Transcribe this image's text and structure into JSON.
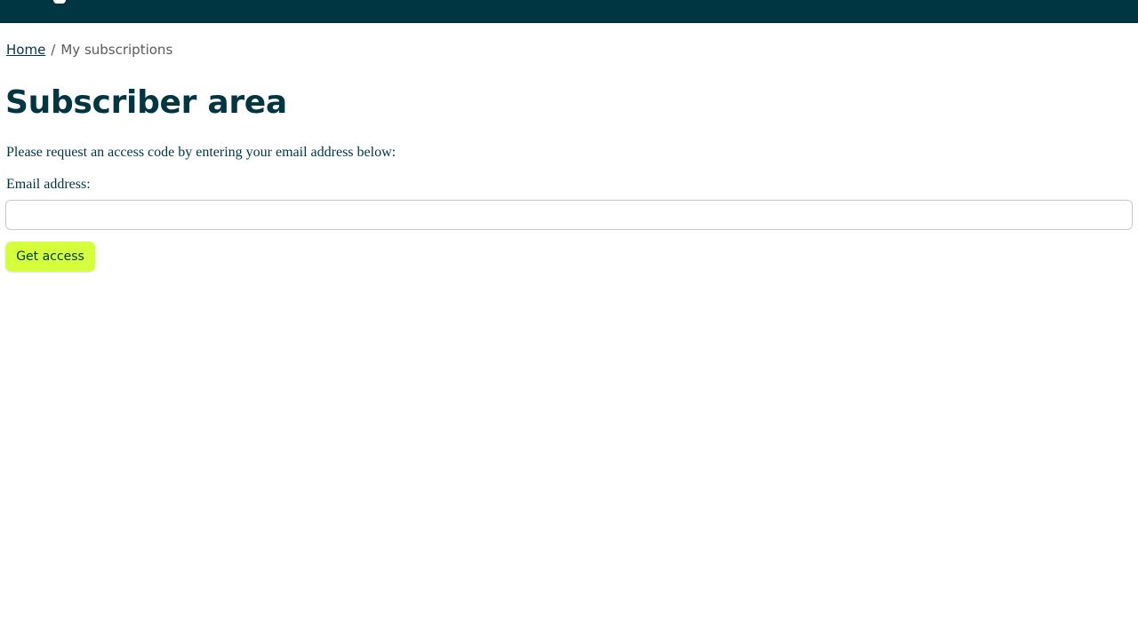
{
  "breadcrumb": {
    "home_label": "Home",
    "separator": "/",
    "current_label": "My subscriptions"
  },
  "page": {
    "title": "Subscriber area",
    "intro": "Please request an access code by entering your email address below:"
  },
  "form": {
    "email_label": "Email address:",
    "email_value": "",
    "email_placeholder": "",
    "submit_label": "Get access"
  },
  "colors": {
    "header_bg": "#003641",
    "accent": "#d4ff3a",
    "text": "#003641",
    "muted": "#5a5a5a"
  }
}
